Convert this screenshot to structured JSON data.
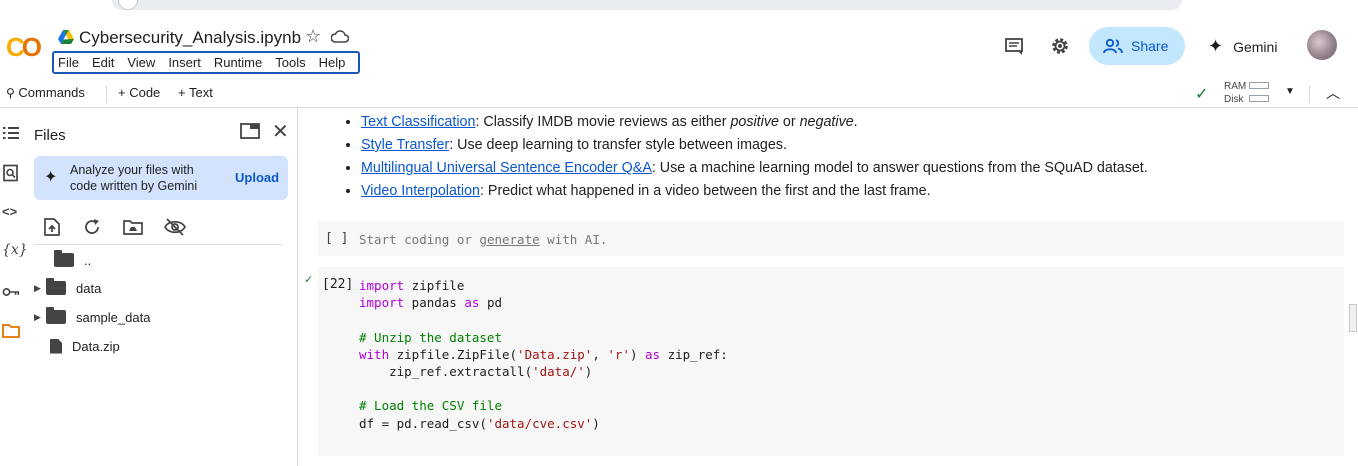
{
  "header": {
    "logo": "CO",
    "title": "Cybersecurity_Analysis.ipynb",
    "menu": [
      "File",
      "Edit",
      "View",
      "Insert",
      "Runtime",
      "Tools",
      "Help"
    ],
    "share_label": "Share",
    "gemini_label": "Gemini"
  },
  "toolbar": {
    "commands_label": "Commands",
    "code_label": "+ Code",
    "text_label": "+ Text",
    "ram_label": "RAM",
    "disk_label": "Disk"
  },
  "files_panel": {
    "title": "Files",
    "banner_text_line1": "Analyze your files with",
    "banner_text_line2": "code written by Gemini",
    "upload_label": "Upload",
    "tree": [
      {
        "name": "..",
        "type": "folder",
        "expandable": false
      },
      {
        "name": "data",
        "type": "folder",
        "expandable": true
      },
      {
        "name": "sample_data",
        "type": "folder",
        "expandable": true
      },
      {
        "name": "Data.zip",
        "type": "file",
        "expandable": false
      }
    ]
  },
  "notebook": {
    "links": [
      {
        "link": "Text Classification",
        "pre": ": Classify IMDB movie reviews as either ",
        "em1": "positive",
        "mid": " or ",
        "em2": "negative",
        "post": "."
      },
      {
        "link": "Style Transfer",
        "text": ": Use deep learning to transfer style between images."
      },
      {
        "link": "Multilingual Universal Sentence Encoder Q&A",
        "text": ": Use a machine learning model to answer questions from the SQuAD dataset."
      },
      {
        "link": "Video Interpolation",
        "text": ": Predict what happened in a video between the first and the last frame."
      }
    ],
    "empty_cell": {
      "prompt": "[ ]",
      "placeholder_pre": "Start coding or ",
      "placeholder_link": "generate",
      "placeholder_post": " with AI."
    },
    "code_cell": {
      "prompt": "[22]",
      "lines": [
        "import zipfile",
        "import pandas as pd",
        "",
        "# Unzip the dataset",
        "with zipfile.ZipFile('Data.zip', 'r') as zip_ref:",
        "    zip_ref.extractall('data/')",
        "",
        "# Load the CSV file",
        "df = pd.read_csv('data/cve.csv')"
      ]
    }
  },
  "colors": {
    "accent": "#0b57d0",
    "share_bg": "#c2e7ff",
    "banner_bg": "#d3e3fd",
    "logo_orange": "#f9ab00",
    "check_green": "#188038"
  }
}
